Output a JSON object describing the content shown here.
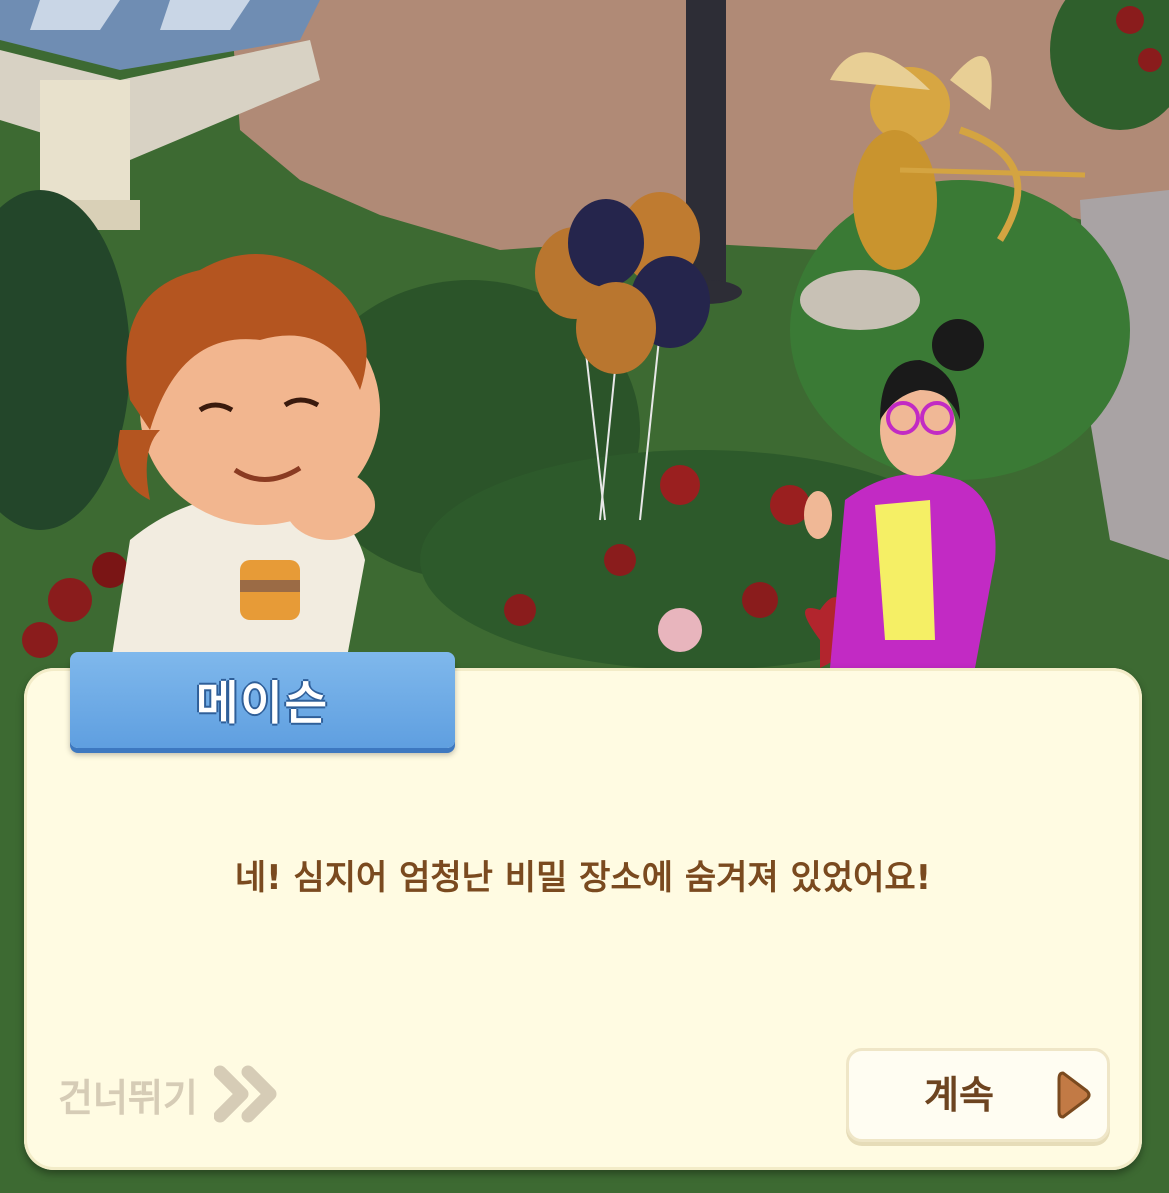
{
  "speaker": {
    "name": "메이슨"
  },
  "dialogue": {
    "text": "네! 심지어 엄청난 비밀 장소에 숨겨져 있었어요!"
  },
  "controls": {
    "skip_label": "건너뛰기",
    "continue_label": "계속"
  },
  "colors": {
    "name_tag": "#6aa9e6",
    "dialog_bg": "#fffbe2",
    "text": "#7a4a1f",
    "skip_text": "#d6ccb6",
    "continue_arrow": "#c27a45"
  },
  "icons": {
    "skip": "double-chevron-right-icon",
    "continue": "play-arrow-icon"
  }
}
